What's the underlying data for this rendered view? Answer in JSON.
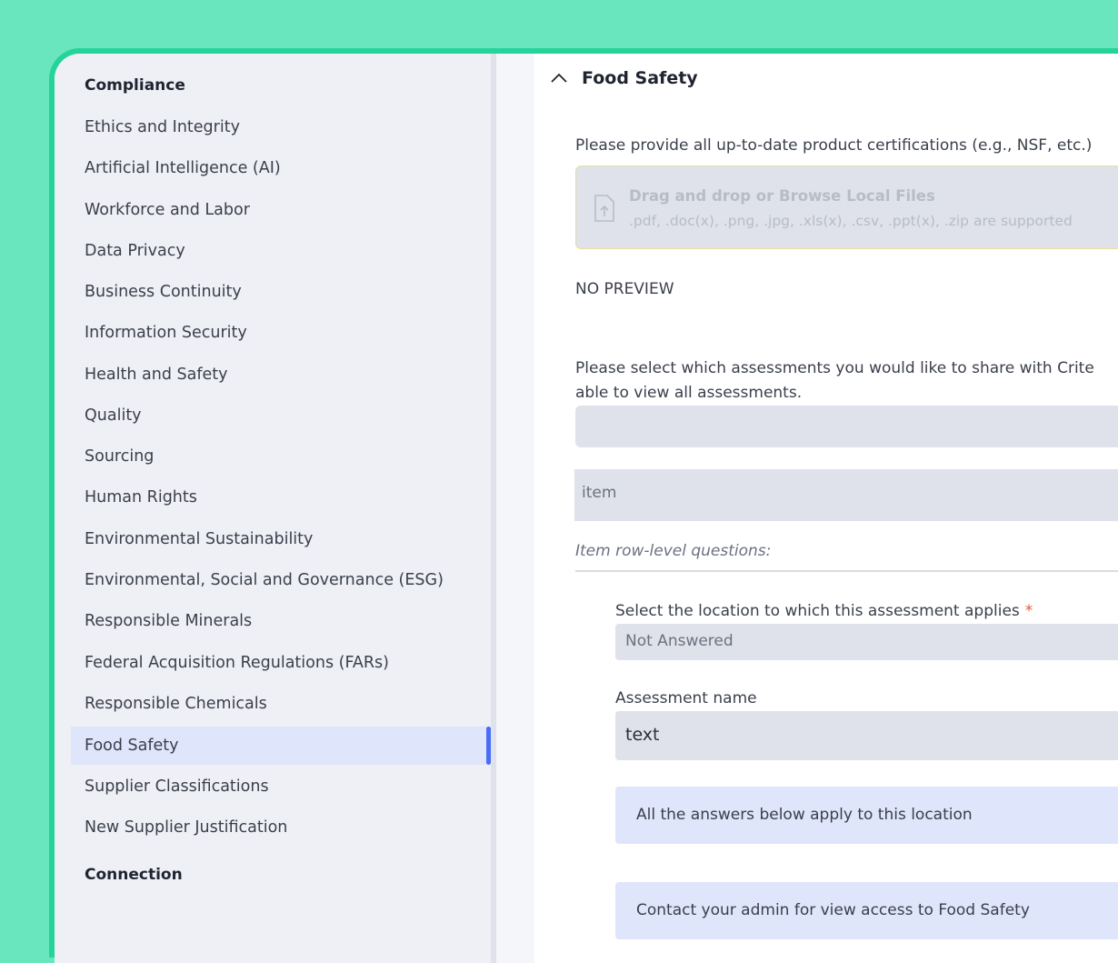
{
  "sidebar": {
    "compliance_title": "Compliance",
    "items": [
      {
        "label": "Ethics and Integrity"
      },
      {
        "label": "Artificial Intelligence (AI)"
      },
      {
        "label": "Workforce and Labor"
      },
      {
        "label": "Data Privacy"
      },
      {
        "label": "Business Continuity"
      },
      {
        "label": "Information Security"
      },
      {
        "label": "Health and Safety"
      },
      {
        "label": "Quality"
      },
      {
        "label": "Sourcing"
      },
      {
        "label": "Human Rights"
      },
      {
        "label": "Environmental Sustainability"
      },
      {
        "label": "Environmental, Social and Governance (ESG)"
      },
      {
        "label": "Responsible Minerals"
      },
      {
        "label": "Federal Acquisition Regulations (FARs)"
      },
      {
        "label": "Responsible Chemicals"
      },
      {
        "label": "Food Safety"
      },
      {
        "label": "Supplier Classifications"
      },
      {
        "label": "New Supplier Justification"
      }
    ],
    "active_item": "Food Safety",
    "connection_title": "Connection"
  },
  "main": {
    "section_title": "Food Safety",
    "certifications_question": "Please provide all up-to-date product certifications (e.g., NSF, etc.)",
    "dropzone": {
      "title": "Drag and drop or Browse Local Files",
      "supported": ".pdf, .doc(x), .png, .jpg, .xls(x), .csv, .ppt(x), .zip are supported"
    },
    "no_preview": "NO PREVIEW",
    "share_question_line1": "Please select which assessments you would like to share with Crite",
    "share_question_line2": "able to view all assessments.",
    "item_field": "item",
    "row_level_label": "Item row-level questions:",
    "location_label": "Select the location to which this assessment applies",
    "required_mark": "*",
    "location_value": "Not Answered",
    "assessment_name_label": "Assessment name",
    "assessment_name_value": "text",
    "info_location": "All the answers below apply to this location",
    "info_contact": "Contact your admin for view access to Food Safety"
  },
  "colors": {
    "background": "#6ae6bf",
    "accent": "#4a6cf7",
    "active_item_bg": "#dfe5fb",
    "required": "#e0573a"
  }
}
